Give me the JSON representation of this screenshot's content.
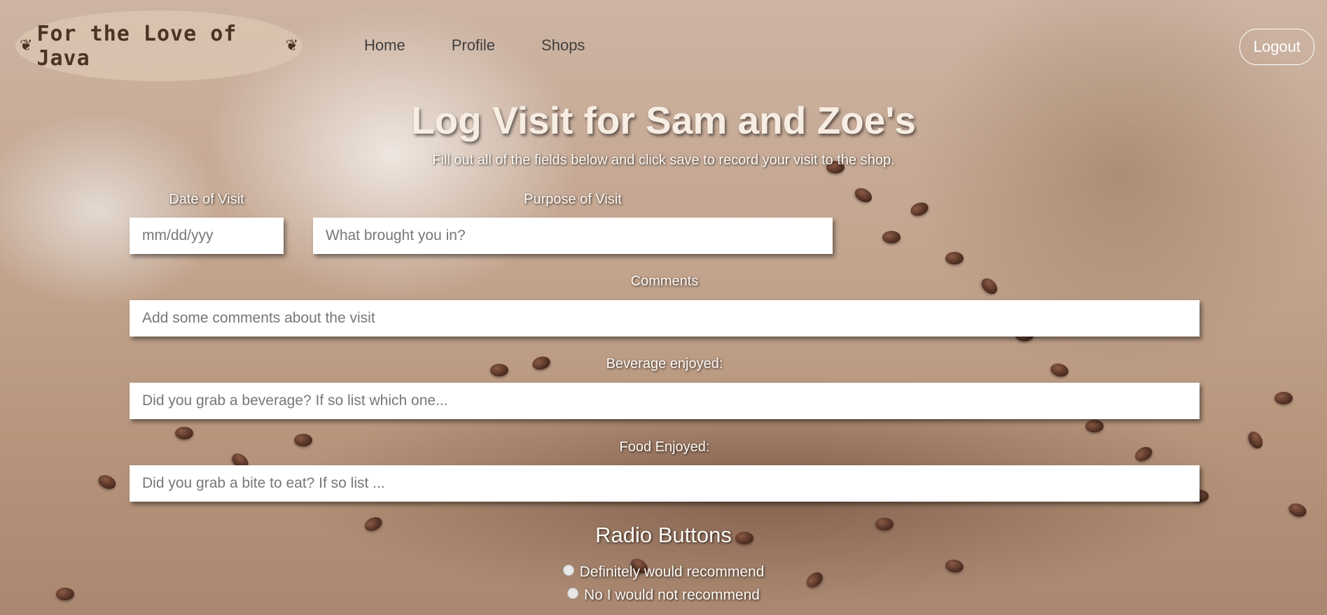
{
  "header": {
    "logo_text": "For the Love of Java",
    "nav": [
      {
        "label": "Home"
      },
      {
        "label": "Profile"
      },
      {
        "label": "Shops"
      }
    ],
    "logout_label": "Logout"
  },
  "main": {
    "title": "Log Visit for Sam and Zoe's",
    "subtitle": "Fill out all of the fields below and click save to record your visit to the shop.",
    "fields": {
      "date": {
        "label": "Date of Visit",
        "placeholder": "mm/dd/yyy"
      },
      "purpose": {
        "label": "Purpose of Visit",
        "placeholder": "What brought you in?"
      },
      "comments": {
        "label": "Comments",
        "placeholder": "Add some comments about the visit"
      },
      "beverage": {
        "label": "Beverage enjoyed:",
        "placeholder": "Did you grab a beverage? If so list which one..."
      },
      "food": {
        "label": "Food Enjoyed:",
        "placeholder": "Did you grab a bite to eat? If so list ..."
      }
    },
    "radios": {
      "title": "Radio Buttons",
      "options": [
        {
          "label": "Definitely would recommend"
        },
        {
          "label": "No I would not recommend"
        }
      ]
    }
  }
}
